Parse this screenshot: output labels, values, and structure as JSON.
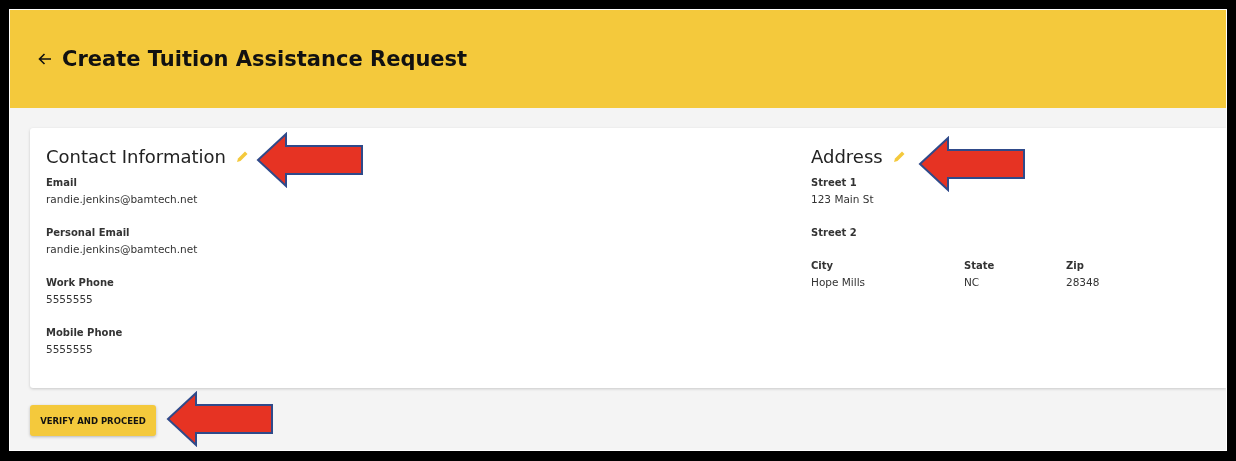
{
  "header": {
    "title": "Create Tuition Assistance Request"
  },
  "contact": {
    "title": "Contact Information",
    "fields": [
      {
        "label": "Email",
        "value": "randie.jenkins@bamtech.net"
      },
      {
        "label": "Personal Email",
        "value": "randie.jenkins@bamtech.net"
      },
      {
        "label": "Work Phone",
        "value": "5555555"
      },
      {
        "label": "Mobile Phone",
        "value": "5555555"
      }
    ]
  },
  "address": {
    "title": "Address",
    "fields": [
      {
        "label": "Street 1",
        "value": "123 Main St"
      },
      {
        "label": "Street 2"
      }
    ],
    "row": [
      {
        "label": "City",
        "value": "Hope Mills"
      },
      {
        "label": "State",
        "value": "NC"
      },
      {
        "label": "Zip",
        "value": "28348"
      }
    ]
  },
  "button": {
    "label": "VERIFY AND PROCEED"
  }
}
